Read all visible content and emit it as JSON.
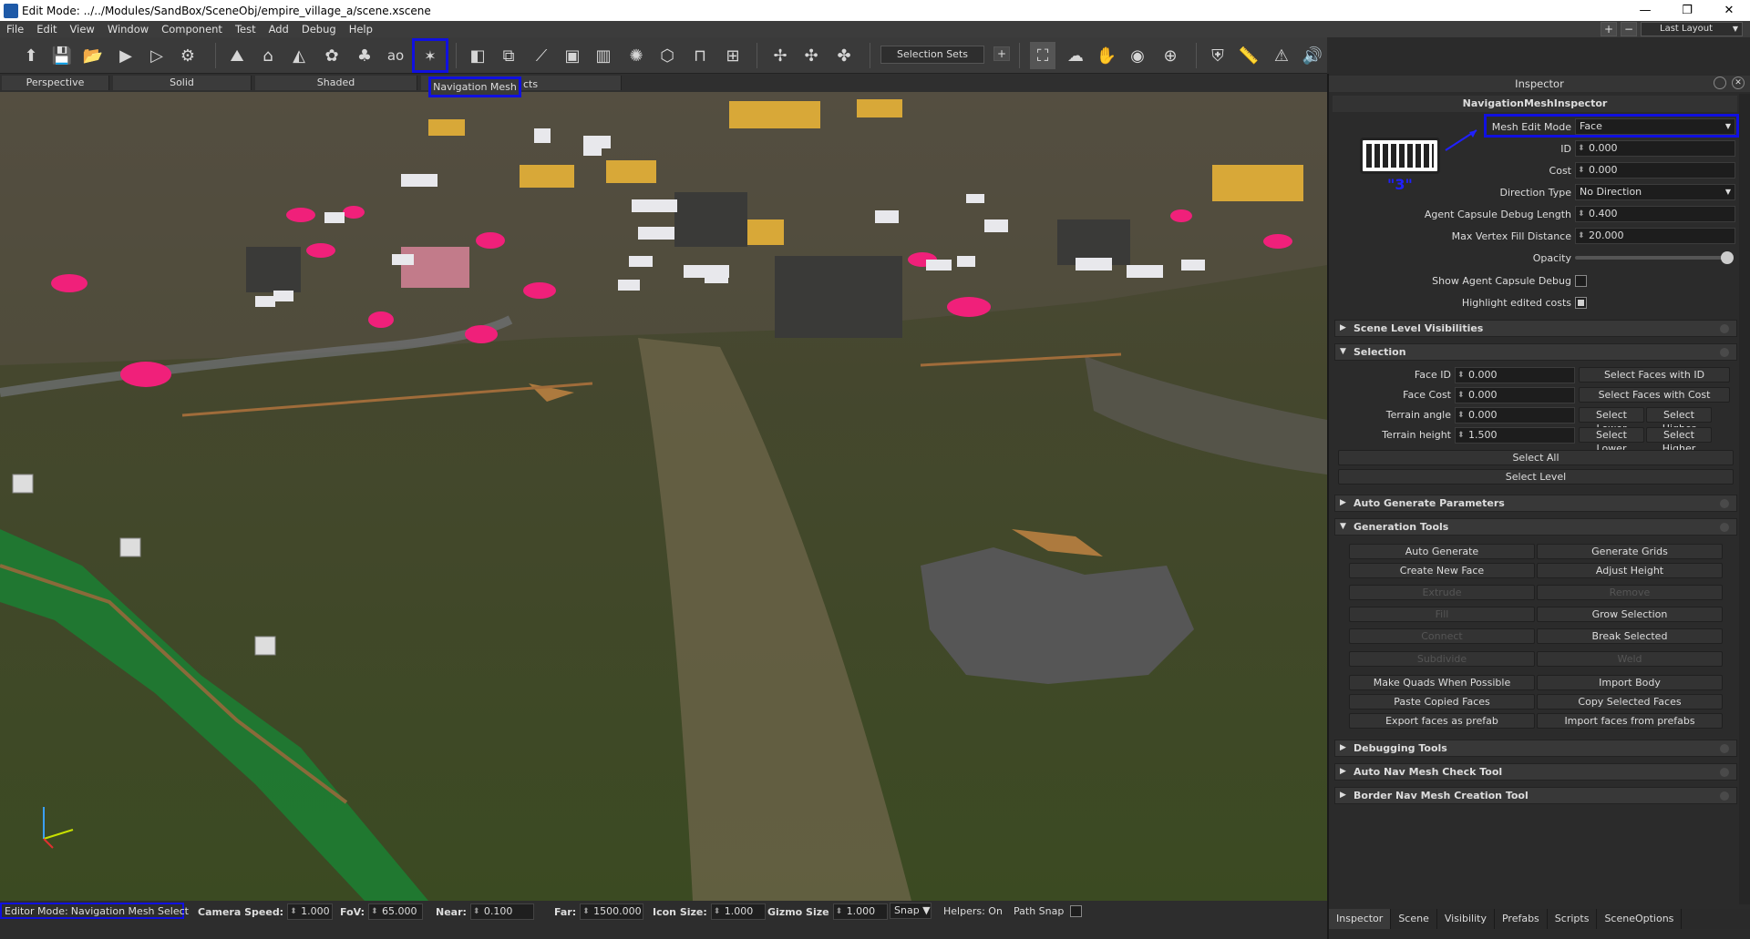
{
  "window": {
    "title": "Edit Mode: ../../Modules/SandBox/SceneObj/empire_village_a/scene.xscene",
    "minimize": "—",
    "maximize": "❐",
    "close": "✕"
  },
  "menu": {
    "items": [
      "File",
      "Edit",
      "View",
      "Window",
      "Component",
      "Test",
      "Add",
      "Debug",
      "Help"
    ],
    "add": "+",
    "remove": "−",
    "layout": "Last Layout"
  },
  "toolbar": {
    "selection_sets": "Selection Sets",
    "plus": "+",
    "ao_label": "ao",
    "tooltip": "Navigation Mesh",
    "tooltip_rest": "cts"
  },
  "view_tabs": [
    "Perspective",
    "Solid",
    "Shaded"
  ],
  "viewport": {
    "annotation": "\"3\""
  },
  "status": {
    "editor_mode_label": "Editor Mode:",
    "editor_mode_value": "Navigation Mesh Select",
    "camera_speed_label": "Camera Speed:",
    "camera_speed": "1.000",
    "fov_label": "FoV:",
    "fov": "65.000",
    "near_label": "Near:",
    "near": "0.100",
    "far_label": "Far:",
    "far": "1500.000",
    "icon_size_label": "Icon Size:",
    "icon_size": "1.000",
    "gizmo_size_label": "Gizmo Size",
    "gizmo_size": "1.000",
    "snap": "Snap",
    "helpers": "Helpers: On",
    "path_snap": "Path Snap"
  },
  "inspector": {
    "title": "Inspector",
    "subtitle": "NavigationMeshInspector",
    "props": {
      "mesh_edit_mode_label": "Mesh Edit Mode",
      "mesh_edit_mode": "Face",
      "id_label": "ID",
      "id": "0.000",
      "cost_label": "Cost",
      "cost": "0.000",
      "direction_type_label": "Direction Type",
      "direction_type": "No Direction",
      "agent_capsule_label": "Agent Capsule Debug Length",
      "agent_capsule": "0.400",
      "max_vertex_label": "Max Vertex Fill Distance",
      "max_vertex": "20.000",
      "opacity_label": "Opacity",
      "opacity_fraction": 1.0,
      "show_agent_label": "Show Agent Capsule Debug",
      "show_agent": false,
      "highlight_label": "Highlight edited costs",
      "highlight": true
    },
    "sections": {
      "scene_level": "Scene Level Visibilities",
      "selection": "Selection",
      "auto_gen": "Auto Generate Parameters",
      "gen_tools": "Generation Tools",
      "debugging": "Debugging Tools",
      "auto_check": "Auto Nav Mesh Check Tool",
      "border": "Border Nav Mesh Creation Tool"
    },
    "selection": {
      "face_id_label": "Face ID",
      "face_id": "0.000",
      "select_faces_id": "Select Faces with ID",
      "face_cost_label": "Face Cost",
      "face_cost": "0.000",
      "select_faces_cost": "Select Faces with Cost",
      "terrain_angle_label": "Terrain angle",
      "terrain_angle": "0.000",
      "terrain_height_label": "Terrain height",
      "terrain_height": "1.500",
      "select_lower": "Select Lower",
      "select_higher": "Select Higher",
      "select_all": "Select All",
      "select_level": "Select Level"
    },
    "gen": {
      "auto_generate": "Auto Generate",
      "generate_grids": "Generate Grids",
      "create_new_face": "Create New Face",
      "adjust_height": "Adjust Height",
      "extrude": "Extrude",
      "remove": "Remove",
      "fill": "Fill",
      "grow_selection": "Grow Selection",
      "connect": "Connect",
      "break_selected": "Break Selected",
      "subdivide": "Subdivide",
      "weld": "Weld",
      "make_quads": "Make Quads When Possible",
      "import_body": "Import Body",
      "paste_copied": "Paste Copied Faces",
      "copy_selected": "Copy Selected Faces",
      "export_faces": "Export faces as prefab",
      "import_faces": "Import faces from prefabs"
    },
    "bottom_tabs": [
      "Inspector",
      "Scene",
      "Visibility",
      "Prefabs",
      "Scripts",
      "SceneOptions"
    ]
  },
  "colors": {
    "highlight": "#1010e0",
    "accent": "#e8b23a",
    "pink": "#f0207a"
  }
}
